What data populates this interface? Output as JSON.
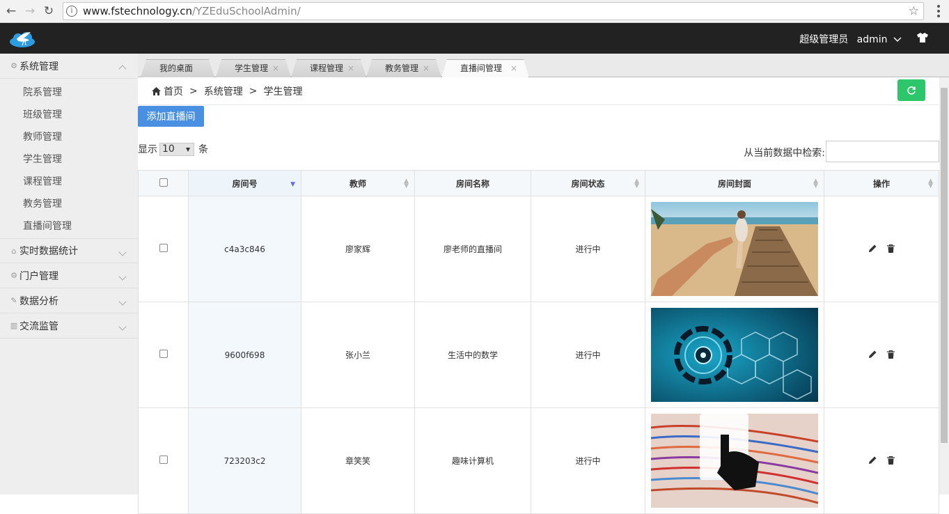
{
  "browser": {
    "url_host": "www.fstechnology.cn",
    "url_path": "/YZEduSchoolAdmin/"
  },
  "header": {
    "role": "超级管理员",
    "username": "admin"
  },
  "sidebar": {
    "system": {
      "label": "系统管理",
      "items": [
        {
          "label": "院系管理"
        },
        {
          "label": "班级管理"
        },
        {
          "label": "教师管理"
        },
        {
          "label": "学生管理"
        },
        {
          "label": "课程管理"
        },
        {
          "label": "教务管理"
        },
        {
          "label": "直播间管理"
        }
      ]
    },
    "groups": [
      {
        "label": "实时数据统计",
        "icon": "home-icon"
      },
      {
        "label": "门户管理",
        "icon": "gear-icon"
      },
      {
        "label": "数据分析",
        "icon": "pencil-icon"
      },
      {
        "label": "交流监管",
        "icon": "building-icon"
      }
    ]
  },
  "tabs": [
    {
      "label": "我的桌面",
      "closable": false
    },
    {
      "label": "学生管理",
      "closable": true
    },
    {
      "label": "课程管理",
      "closable": true
    },
    {
      "label": "教务管理",
      "closable": true
    },
    {
      "label": "直播间管理",
      "closable": true,
      "active": true
    }
  ],
  "close_glyph": "×",
  "breadcrumb": {
    "home": "首页",
    "sep": ">",
    "level1": "系统管理",
    "level2": "学生管理"
  },
  "toolbar": {
    "add_label": "添加直播间"
  },
  "list": {
    "show_label": "显示",
    "page_size": "10",
    "unit_label": "条",
    "search_label": "从当前数据中检索:"
  },
  "table": {
    "columns": [
      "房间号",
      "教师",
      "房间名称",
      "房间状态",
      "房间封面",
      "操作"
    ],
    "rows": [
      {
        "room_id": "c4a3c846",
        "teacher": "廖家辉",
        "room_name": "廖老师的直播间",
        "status": "进行中",
        "cover": "beach-boardwalk-photo"
      },
      {
        "room_id": "9600f698",
        "teacher": "张小兰",
        "room_name": "生活中的数学",
        "status": "进行中",
        "cover": "tech-circuit-illustration"
      },
      {
        "room_id": "723203c2",
        "teacher": "章笑笑",
        "room_name": "趣味计算机",
        "status": "进行中",
        "cover": "colorful-lines-photo"
      }
    ]
  },
  "colors": {
    "topbar": "#222222",
    "add_button": "#4a90e2",
    "refresh_button": "#2ec66b"
  }
}
